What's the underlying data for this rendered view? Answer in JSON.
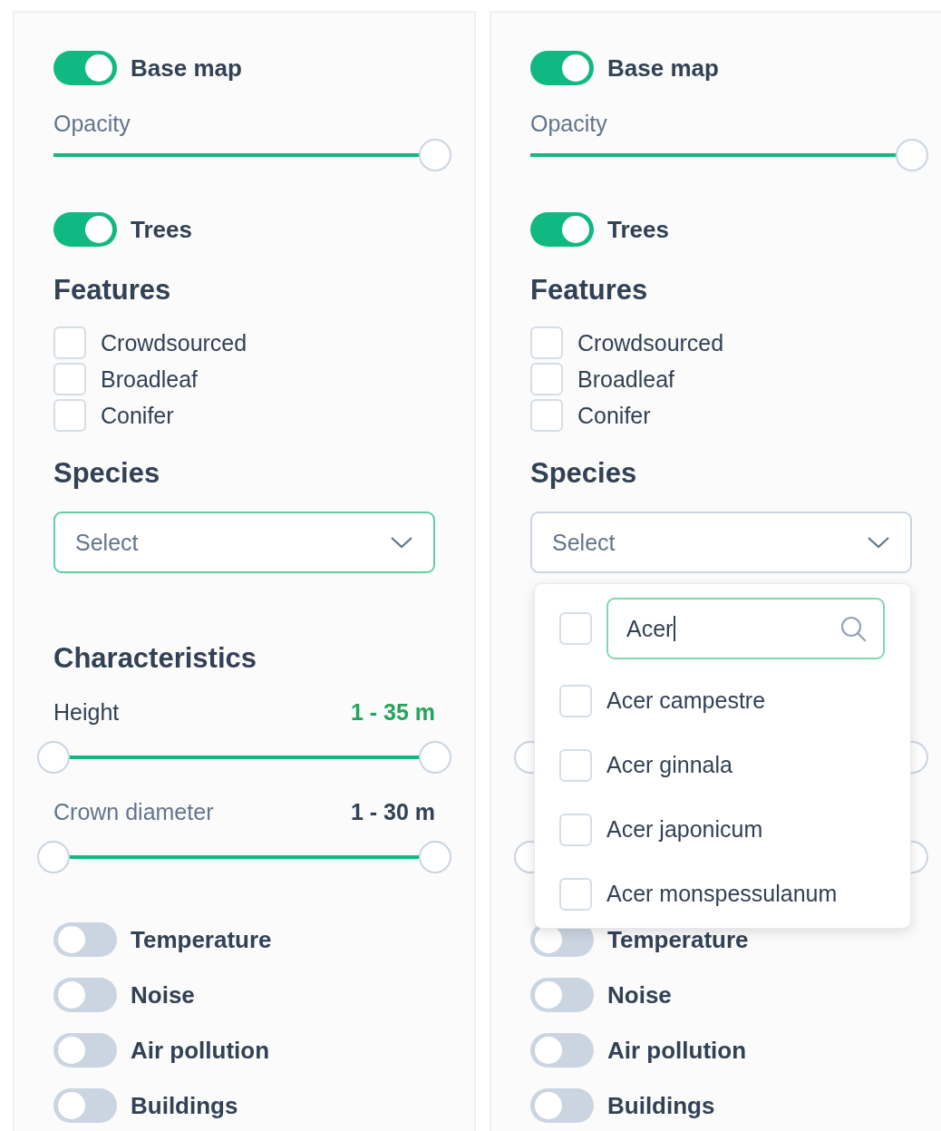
{
  "panels": [
    {
      "base_map": {
        "label": "Base map",
        "on": true
      },
      "opacity": {
        "label": "Opacity",
        "level": 1
      },
      "trees": {
        "label": "Trees",
        "on": true
      },
      "features": {
        "title": "Features",
        "items": [
          {
            "label": "Crowdsourced",
            "checked": false
          },
          {
            "label": "Broadleaf",
            "checked": false
          },
          {
            "label": "Conifer",
            "checked": false
          }
        ]
      },
      "species": {
        "title": "Species",
        "select": {
          "placeholder": "Select",
          "focused": true
        }
      },
      "characteristics": {
        "title": "Characteristics",
        "sliders": [
          {
            "label": "Height",
            "value": "1 - 35 m",
            "active": true,
            "thumbs": [
              {
                "level": 0
              },
              {
                "level": 1
              }
            ]
          },
          {
            "label": "Crown diameter",
            "value": "1 - 30 m",
            "active": false,
            "thumbs": [
              {
                "level": 0
              },
              {
                "level": 1
              }
            ]
          }
        ]
      },
      "layers": [
        {
          "label": "Temperature",
          "on": false
        },
        {
          "label": "Noise",
          "on": false
        },
        {
          "label": "Air pollution",
          "on": false
        },
        {
          "label": "Buildings",
          "on": false
        }
      ]
    },
    {
      "base_map": {
        "label": "Base map",
        "on": true
      },
      "opacity": {
        "label": "Opacity",
        "level": 1
      },
      "trees": {
        "label": "Trees",
        "on": true
      },
      "features": {
        "title": "Features",
        "items": [
          {
            "label": "Crowdsourced",
            "checked": false
          },
          {
            "label": "Broadleaf",
            "checked": false
          },
          {
            "label": "Conifer",
            "checked": false
          }
        ]
      },
      "species": {
        "title": "Species",
        "select": {
          "placeholder": "Select",
          "focused": false
        },
        "dropdown": {
          "select_all": {
            "checked": false
          },
          "search": {
            "value": "Acer",
            "focused": true
          },
          "options": [
            {
              "label": "Acer campestre",
              "checked": false
            },
            {
              "label": "Acer ginnala",
              "checked": false
            },
            {
              "label": "Acer japonicum",
              "checked": false
            },
            {
              "label": "Acer monspessulanum",
              "checked": false
            }
          ]
        }
      },
      "characteristics": {
        "sliders": [
          {
            "thumbs": [
              {
                "level": 0
              },
              {
                "level": 1
              }
            ]
          },
          {
            "thumbs": [
              {
                "level": 0
              },
              {
                "level": 1
              }
            ]
          }
        ]
      },
      "layers": [
        {
          "label": "Temperature",
          "on": false
        },
        {
          "label": "Noise",
          "on": false
        },
        {
          "label": "Air pollution",
          "on": false
        },
        {
          "label": "Buildings",
          "on": false
        }
      ]
    }
  ]
}
